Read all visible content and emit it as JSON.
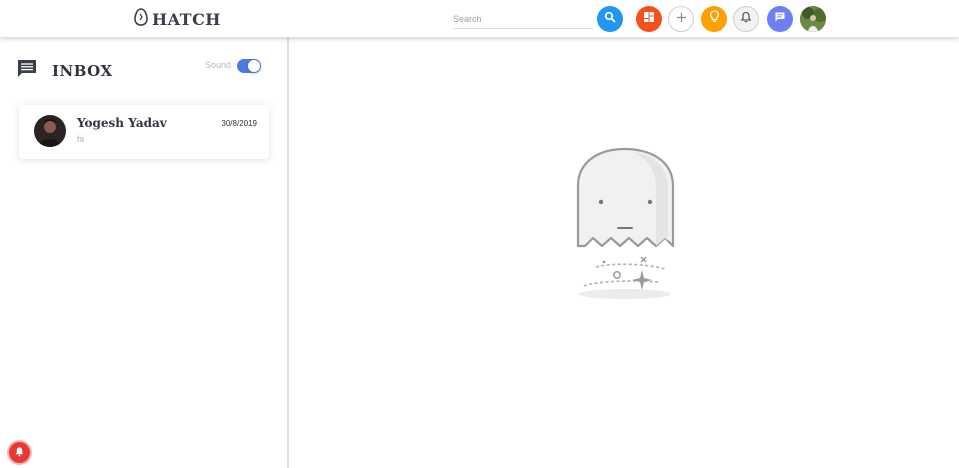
{
  "app": {
    "brand": "HATCH",
    "brand_icon": "egg-icon"
  },
  "header": {
    "search": {
      "placeholder": "Search",
      "value": ""
    },
    "buttons": [
      {
        "name": "search-button",
        "icon": "search-icon",
        "color": "#2196f3"
      },
      {
        "name": "dashboard-button",
        "icon": "dashboard-icon",
        "color": "#f4511e"
      },
      {
        "name": "add-button",
        "icon": "plus-icon",
        "color": "#ffffff"
      },
      {
        "name": "ideas-button",
        "icon": "lightbulb-icon",
        "color": "#ffa000"
      },
      {
        "name": "notifications-button",
        "icon": "bell-icon",
        "color": "#f2f2f2"
      },
      {
        "name": "messages-button",
        "icon": "chat-icon",
        "color": "#6e7ff3"
      },
      {
        "name": "profile-avatar",
        "icon": "avatar",
        "color": "#5a7a3a"
      }
    ]
  },
  "sidebar": {
    "title": "INBOX",
    "title_icon": "message-icon",
    "sound_label": "Sound",
    "sound_on": true,
    "messages": [
      {
        "name": "Yogesh Yadav",
        "date": "30/8/2019",
        "preview": "hi"
      }
    ]
  },
  "main": {
    "empty_state_icon": "ghost-icon"
  },
  "colors": {
    "accent": "#4a7be0",
    "text": "#2f3440",
    "alert": "#e53935"
  }
}
